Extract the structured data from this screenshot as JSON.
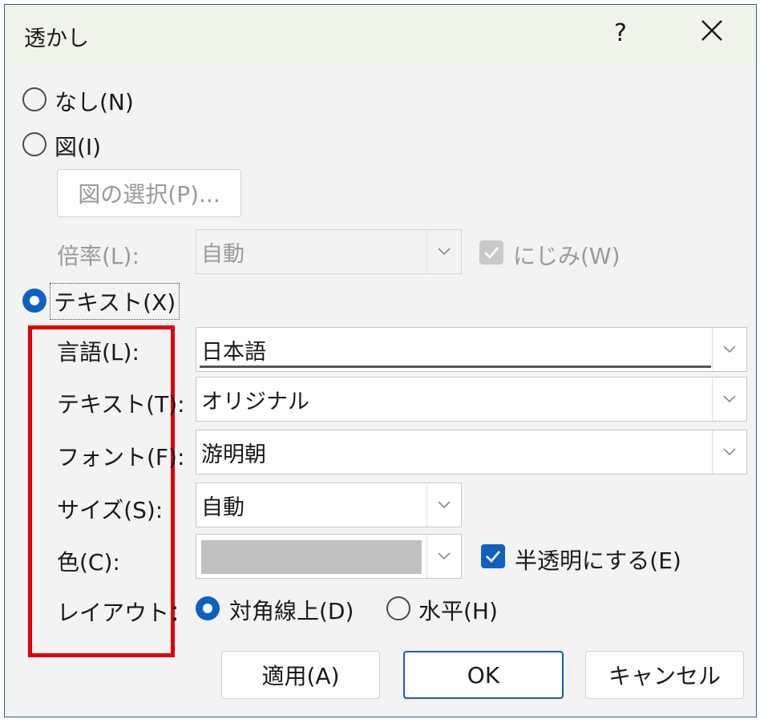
{
  "dialog": {
    "title": "透かし",
    "help_label": "?",
    "close_icon": "close-icon"
  },
  "options": {
    "none_label": "なし(N)",
    "picture_label": "図(I)",
    "select_picture_button": "図の選択(P)...",
    "scale_label": "倍率(L):",
    "scale_value": "自動",
    "washout_label": "にじみ(W)",
    "text_label": "テキスト(X)"
  },
  "text_settings": {
    "language_label": "言語(L):",
    "language_value": "日本語",
    "text_label": "テキスト(T):",
    "text_value": "オリジナル",
    "font_label": "フォント(F):",
    "font_value": "游明朝",
    "size_label": "サイズ(S):",
    "size_value": "自動",
    "color_label": "色(C):",
    "color_value": "#c0c0c0",
    "semitransparent_label": "半透明にする(E)",
    "layout_label": "レイアウト：",
    "diagonal_label": "対角線上(D)",
    "horizontal_label": "水平(H)"
  },
  "buttons": {
    "apply": "適用(A)",
    "ok": "OK",
    "cancel": "キャンセル"
  },
  "colors": {
    "accent": "#1060c0",
    "highlight_box": "#e00000"
  }
}
